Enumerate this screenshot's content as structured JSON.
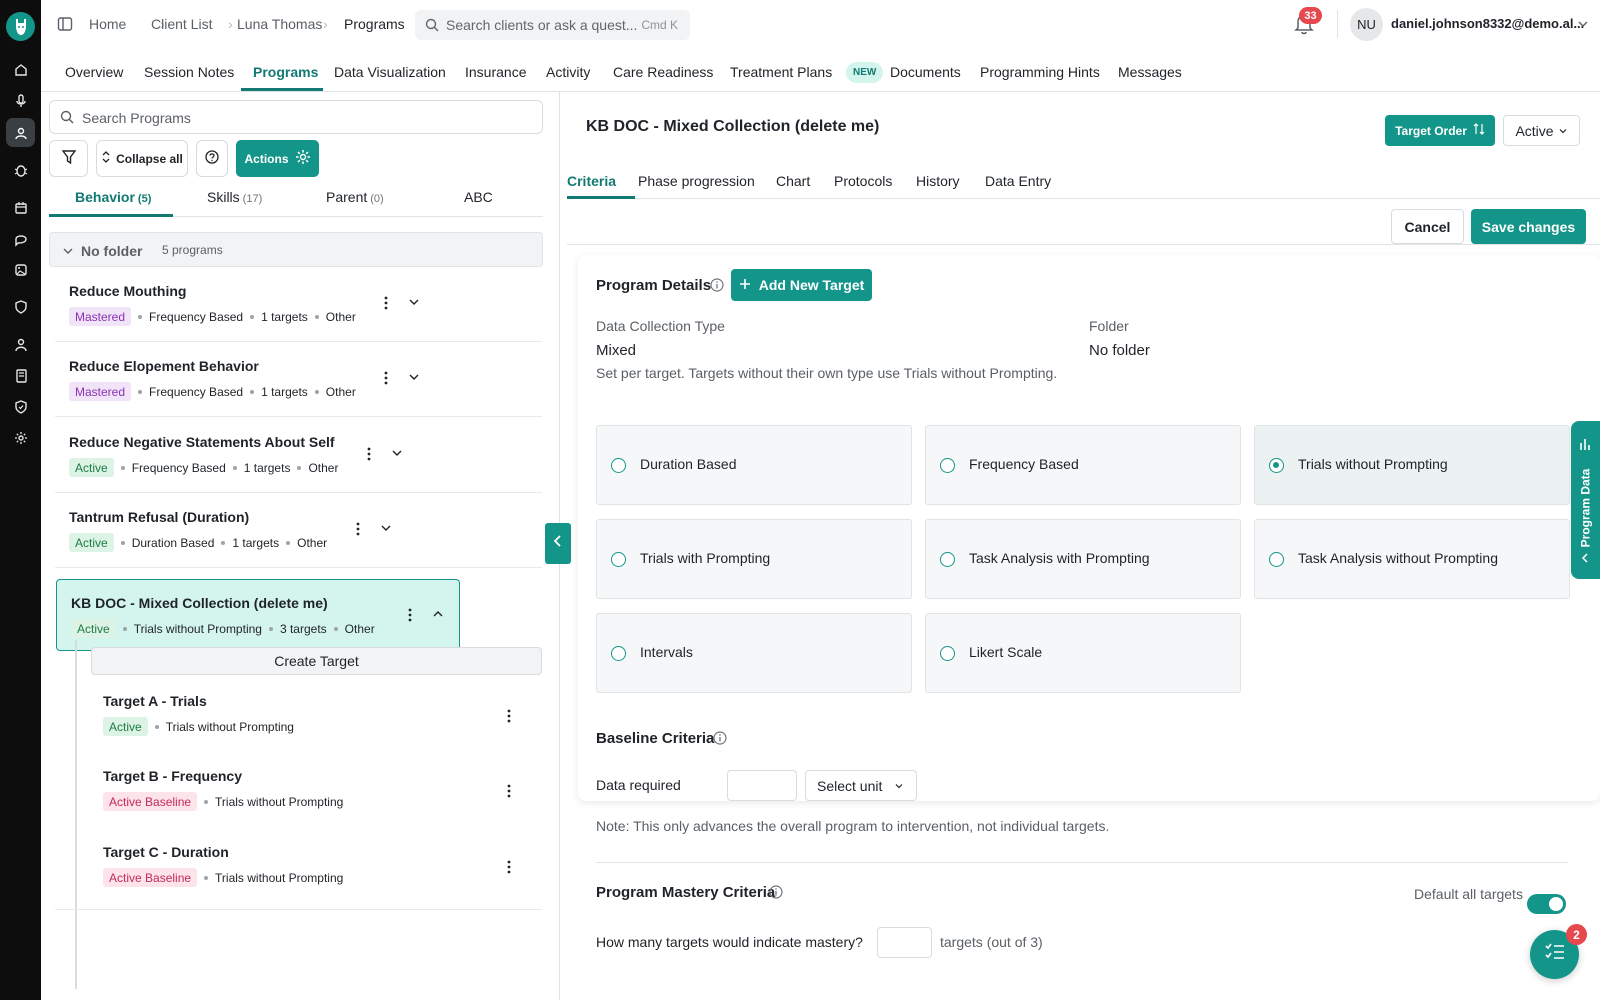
{
  "rail": {
    "icons": [
      "home-icon",
      "microphone-icon",
      "clients-icon",
      "bug-icon",
      "calendar-icon",
      "chat-icon",
      "gallery-icon",
      "shield-icon",
      "person-icon",
      "book-icon",
      "shield-check-icon",
      "settings-gear-icon"
    ]
  },
  "breadcrumb": [
    "Home",
    "Client List",
    "Luna Thomas",
    "Programs"
  ],
  "search": {
    "placeholder": "Search clients or ask a quest...",
    "shortcut": "Cmd K"
  },
  "notifications": {
    "count": "33"
  },
  "user": {
    "initials": "NU",
    "email": "daniel.johnson8332@demo.al..."
  },
  "nav_tabs": [
    "Overview",
    "Session Notes",
    "Programs",
    "Data Visualization",
    "Insurance",
    "Activity",
    "Care Readiness",
    "Treatment Plans",
    "Documents",
    "Programming Hints",
    "Messages"
  ],
  "new_badge": "NEW",
  "left": {
    "search_placeholder": "Search Programs",
    "collapse_label": "Collapse all",
    "actions_label": "Actions",
    "tabs": [
      {
        "label": "Behavior",
        "count": "(5)"
      },
      {
        "label": "Skills",
        "count": "(17)"
      },
      {
        "label": "Parent",
        "count": "(0)"
      },
      {
        "label": "ABC",
        "count": ""
      }
    ],
    "folder": {
      "name": "No folder",
      "count": "5 programs"
    },
    "programs": [
      {
        "name": "Reduce Mouthing",
        "status": "Mastered",
        "type": "Frequency Based",
        "targets": "1 targets",
        "category": "Other"
      },
      {
        "name": "Reduce Elopement Behavior",
        "status": "Mastered",
        "type": "Frequency Based",
        "targets": "1 targets",
        "category": "Other"
      },
      {
        "name": "Reduce Negative Statements About Self",
        "status": "Active",
        "type": "Frequency Based",
        "targets": "1 targets",
        "category": "Other"
      },
      {
        "name": "Tantrum Refusal (Duration)",
        "status": "Active",
        "type": "Duration Based",
        "targets": "1 targets",
        "category": "Other"
      },
      {
        "name": "KB DOC - Mixed Collection (delete me)",
        "status": "Active",
        "type": "Trials without Prompting",
        "targets": "3 targets",
        "category": "Other"
      }
    ],
    "create_target": "Create Target",
    "targets": [
      {
        "name": "Target A - Trials",
        "status": "Active",
        "type": "Trials without Prompting"
      },
      {
        "name": "Target B - Frequency",
        "status": "Active Baseline",
        "type": "Trials without Prompting"
      },
      {
        "name": "Target C - Duration",
        "status": "Active Baseline",
        "type": "Trials without Prompting"
      }
    ]
  },
  "right": {
    "title": "KB DOC - Mixed Collection (delete me)",
    "target_order": "Target Order",
    "status": "Active",
    "tabs": [
      "Criteria",
      "Phase progression",
      "Chart",
      "Protocols",
      "History",
      "Data Entry"
    ],
    "cancel": "Cancel",
    "save": "Save changes",
    "details_title": "Program Details",
    "add_target": "Add New Target",
    "dct_label": "Data Collection Type",
    "dct_value": "Mixed",
    "folder_label": "Folder",
    "folder_value": "No folder",
    "dct_hint": "Set per target. Targets without their own type use Trials without Prompting.",
    "options": [
      "Duration Based",
      "Frequency Based",
      "Trials without Prompting",
      "Trials with Prompting",
      "Task Analysis with Prompting",
      "Task Analysis without Prompting",
      "Intervals",
      "Likert Scale"
    ],
    "selected_option": "Trials without Prompting",
    "baseline_title": "Baseline Criteria",
    "data_required": "Data required",
    "select_unit": "Select unit",
    "note": "Note: This only advances the overall program to intervention, not individual targets.",
    "mastery_title": "Program Mastery Criteria",
    "default_all": "Default all targets",
    "mastery_question": "How many targets would indicate mastery?",
    "mastery_suffix": "targets (out of 3)",
    "program_data": "Program Data"
  },
  "fab_badge": "2",
  "colors": {
    "accent": "#14958a",
    "accent_light": "#d4f5ee",
    "badge_red": "#e5484d"
  }
}
